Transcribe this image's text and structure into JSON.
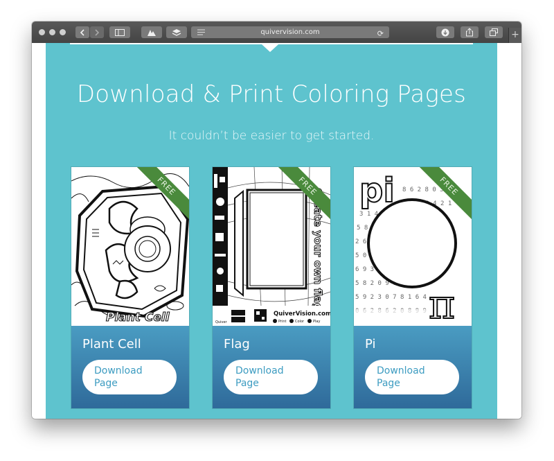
{
  "browser": {
    "url": "quivervision.com",
    "new_tab_label": "+",
    "reload_glyph": "⟳"
  },
  "hero": {
    "title": "Download & Print Coloring Pages",
    "subtitle": "It couldn’t be easier to get started."
  },
  "cards": [
    {
      "title": "Plant Cell",
      "badge": "FREE",
      "button": "Download\nPage",
      "art_text": "Plant Cell"
    },
    {
      "title": "Flag",
      "badge": "FREE",
      "button": "Download\nPage",
      "art_text": "Create your own flag!",
      "art_footer": "QuiverVision.com",
      "art_steps": [
        "Print",
        "Color",
        "Play"
      ],
      "art_brand": "Quiver"
    },
    {
      "title": "Pi",
      "badge": "FREE",
      "button": "Download\nPage",
      "art_text": "pi",
      "art_symbol": "π"
    }
  ],
  "colors": {
    "section_bg": "#5ec3ce",
    "card_footer_top": "#4a9cc2",
    "card_footer_bottom": "#2f6a9a",
    "ribbon": "#4a8a3c",
    "button_text": "#3d9cc1"
  }
}
